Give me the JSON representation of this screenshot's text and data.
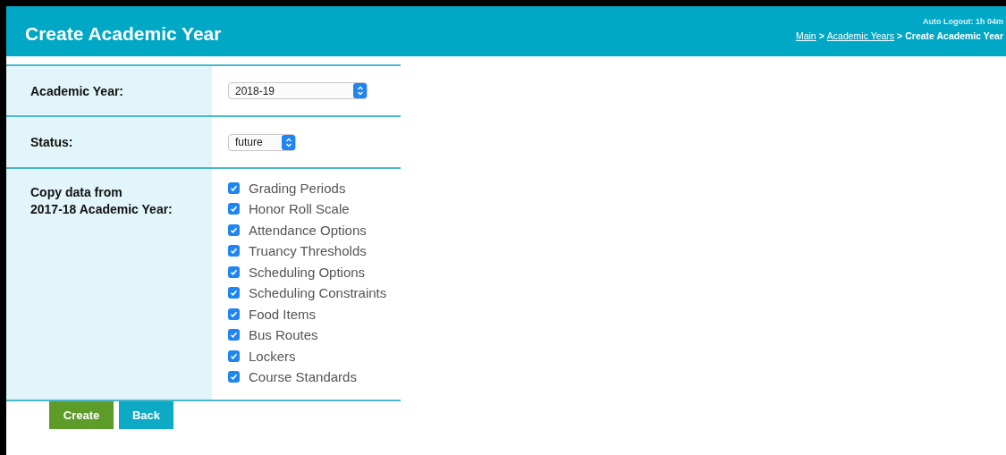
{
  "header": {
    "title": "Create Academic Year",
    "auto_logout": "Auto Logout: 1h 04m",
    "breadcrumb": [
      {
        "label": "Main",
        "kind": "link"
      },
      {
        "label": ">",
        "kind": "separator"
      },
      {
        "label": "Academic Years",
        "kind": "link"
      },
      {
        "label": ">",
        "kind": "separator"
      },
      {
        "label": "Create Academic Year",
        "kind": "current"
      }
    ]
  },
  "form": {
    "academic_year": {
      "label": "Academic Year:",
      "value": "2018-19"
    },
    "status": {
      "label": "Status:",
      "value": "future"
    },
    "copy": {
      "label_lines": [
        "Copy data from",
        "2017-18 Academic Year:"
      ],
      "options": [
        {
          "label": "Grading Periods",
          "checked": true
        },
        {
          "label": "Honor Roll Scale",
          "checked": true
        },
        {
          "label": "Attendance Options",
          "checked": true
        },
        {
          "label": "Truancy Thresholds",
          "checked": true
        },
        {
          "label": "Scheduling Options",
          "checked": true
        },
        {
          "label": "Scheduling Constraints",
          "checked": true
        },
        {
          "label": "Food Items",
          "checked": true
        },
        {
          "label": "Bus Routes",
          "checked": true
        },
        {
          "label": "Lockers",
          "checked": true
        },
        {
          "label": "Course Standards",
          "checked": true
        }
      ]
    }
  },
  "buttons": [
    {
      "label": "Create",
      "kind": "primary"
    },
    {
      "label": "Back",
      "kind": "secondary"
    }
  ]
}
